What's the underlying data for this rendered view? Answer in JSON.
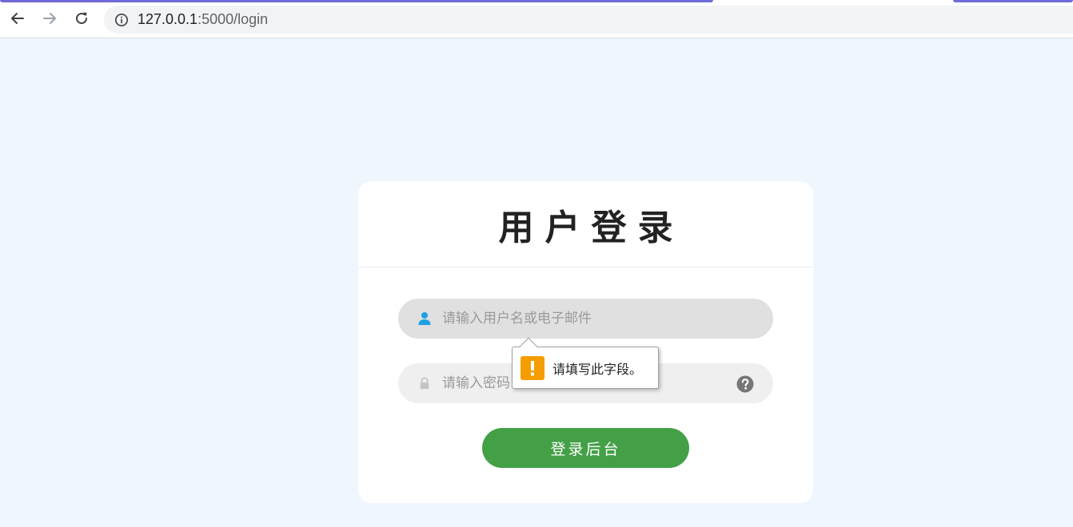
{
  "browser": {
    "url_host": "127.0.0.1",
    "url_rest": ":5000/login",
    "icons": {
      "back": "arrow-left-icon",
      "forward": "arrow-right-icon",
      "reload": "reload-icon",
      "info": "info-icon"
    }
  },
  "login": {
    "title": "用户登录",
    "username_placeholder": "请输入用户名或电子邮件",
    "password_placeholder": "请输入密码",
    "submit_label": "登录后台",
    "icons": {
      "user": "user-icon",
      "lock": "lock-icon",
      "help": "help-icon"
    }
  },
  "validation": {
    "message": "请填写此字段。",
    "icon": "warning-icon"
  },
  "colors": {
    "page_bg": "#eff6fe",
    "accent_user_icon": "#1ea0e6",
    "submit_button": "#43a047",
    "warning": "#f59d00"
  }
}
